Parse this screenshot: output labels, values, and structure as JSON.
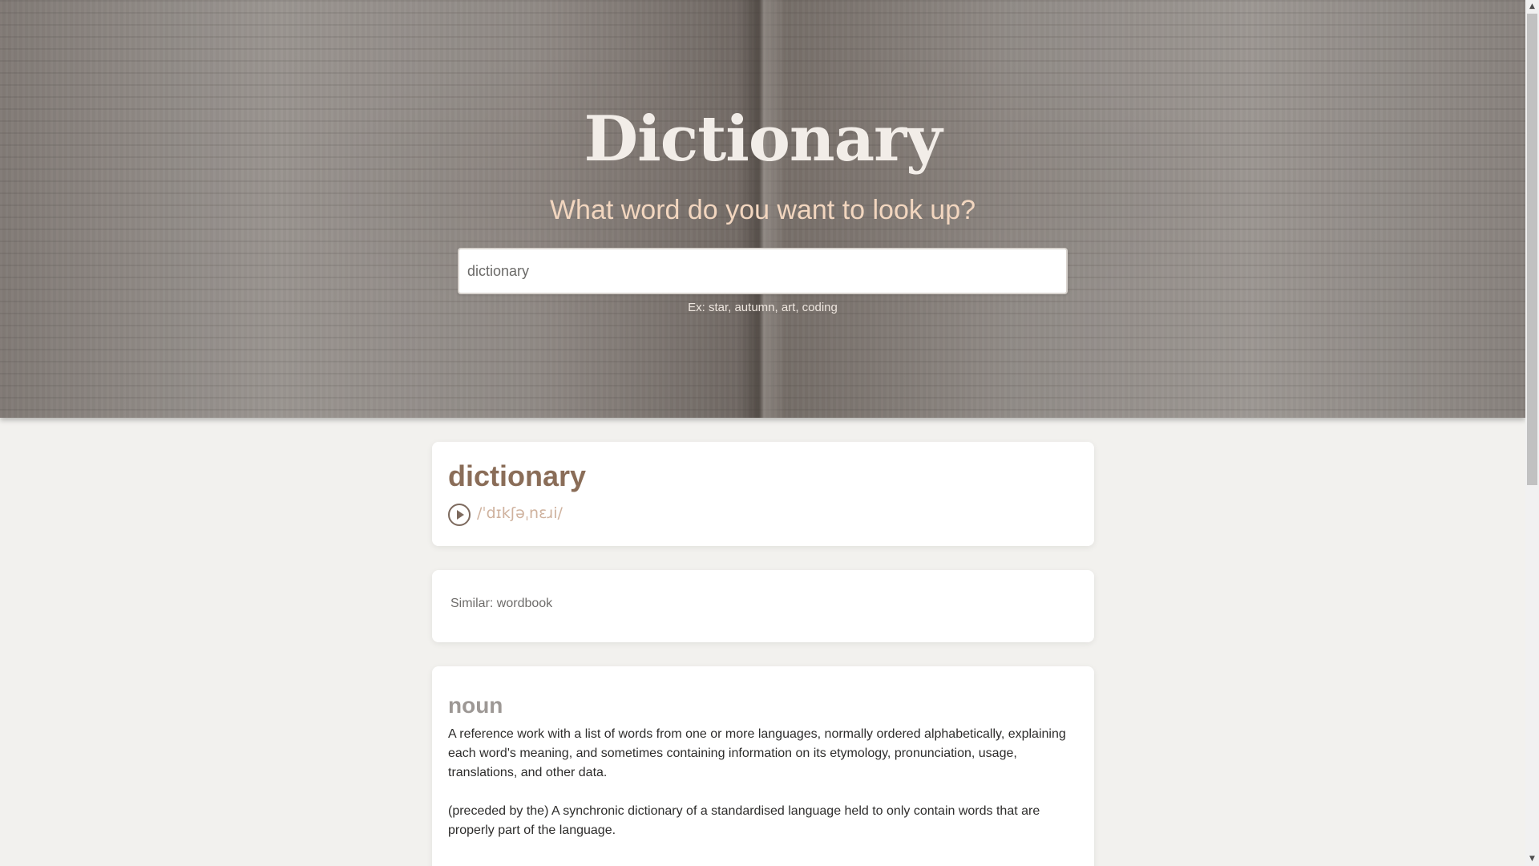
{
  "hero": {
    "title": "Dictionary",
    "subtitle": "What word do you want to look up?",
    "search_value": "dictionary",
    "hint": "Ex: star, autumn, art, coding"
  },
  "result": {
    "word": "dictionary",
    "phonetic": "/ˈdɪkʃəˌnɛɹi/",
    "audio_icon": "play-circle-icon",
    "similar": "Similar: wordbook"
  },
  "meanings": [
    {
      "part_of_speech": "noun",
      "definitions": [
        "A reference work with a list of words from one or more languages, normally ordered alphabetically, explaining each word's meaning, and sometimes containing information on its etymology, pronunciation, usage, translations, and other data.",
        "(preceded by the) A synchronic dictionary of a standardised language held to only contain words that are properly part of the language."
      ]
    }
  ],
  "colors": {
    "accent_brown": "#8a6d58",
    "phonetic_tan": "#cfb29e",
    "subtitle_peach": "#f2d6bf",
    "page_bg": "#f2f1ee"
  },
  "scrollbar": {
    "up_icon": "▲",
    "down_icon": "▼"
  }
}
